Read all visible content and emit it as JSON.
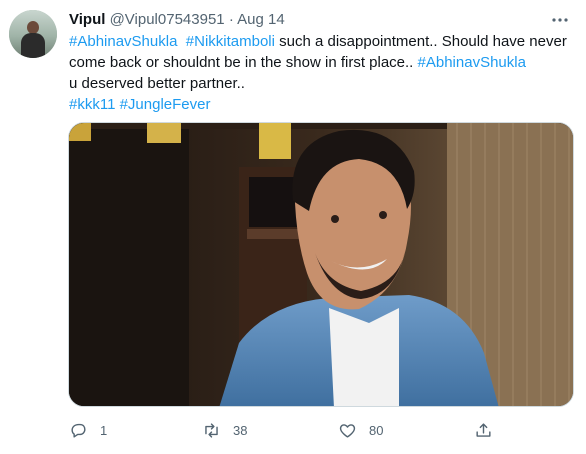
{
  "tweet": {
    "name": "Vipul",
    "handle": "@Vipul07543951",
    "separator": "·",
    "date": "Aug 14",
    "text": {
      "tag1": "#AbhinavShukla",
      "tag2": "#Nikkitamboli",
      "body1": " such a disappointment.. Should have never come back or shouldnt be in the show in first place.. ",
      "tag3": "#AbhinavShukla",
      "body2": " u deserved better partner..",
      "tag4": "#kkk11",
      "tag5": "#JungleFever"
    },
    "more_icon": "more-horizontal-icon"
  },
  "actions": {
    "reply": {
      "icon": "reply-icon",
      "count": "1"
    },
    "retweet": {
      "icon": "retweet-icon",
      "count": "38"
    },
    "like": {
      "icon": "heart-icon",
      "count": "80"
    },
    "share": {
      "icon": "share-icon"
    }
  },
  "colors": {
    "link": "#1d9bf0",
    "muted": "#536471",
    "text": "#0f1419"
  }
}
